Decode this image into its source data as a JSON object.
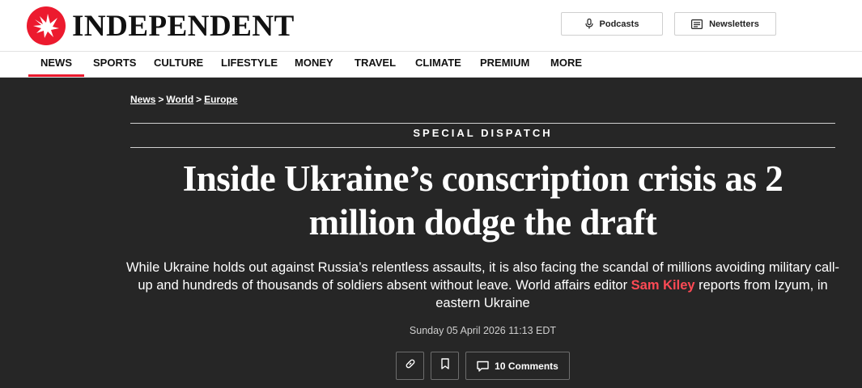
{
  "brand": {
    "name": "INDEPENDENT",
    "accent": "#ec1a2e"
  },
  "header": {
    "podcasts_label": "Podcasts",
    "newsletters_label": "Newsletters"
  },
  "nav": {
    "items": [
      {
        "label": "NEWS",
        "active": true
      },
      {
        "label": "SPORTS"
      },
      {
        "label": "CULTURE"
      },
      {
        "label": "LIFESTYLE"
      },
      {
        "label": "MONEY"
      },
      {
        "label": "TRAVEL"
      },
      {
        "label": "CLIMATE"
      },
      {
        "label": "PREMIUM"
      },
      {
        "label": "MORE"
      }
    ]
  },
  "article": {
    "breadcrumb": [
      "News",
      "World",
      "Europe"
    ],
    "breadcrumb_separator": ">",
    "kicker": "SPECIAL DISPATCH",
    "headline": "Inside Ukraine’s conscription crisis as 2 million dodge the draft",
    "standfirst_before": "While Ukraine holds out against Russia’s relentless assaults, it is also facing the scandal of millions avoiding military call-up and hundreds of thousands of soldiers absent without leave. World affairs editor ",
    "author": "Sam Kiley",
    "standfirst_after": " reports from Izyum, in eastern Ukraine",
    "date": "Sunday 05 April 2026 11:13 EDT",
    "comments_label": "10 Comments",
    "icons": {
      "share": "link-icon",
      "save": "bookmark-icon",
      "comments": "comment-icon"
    }
  },
  "colors": {
    "hero_bg": "#262626",
    "author_link": "#ff4a55"
  }
}
